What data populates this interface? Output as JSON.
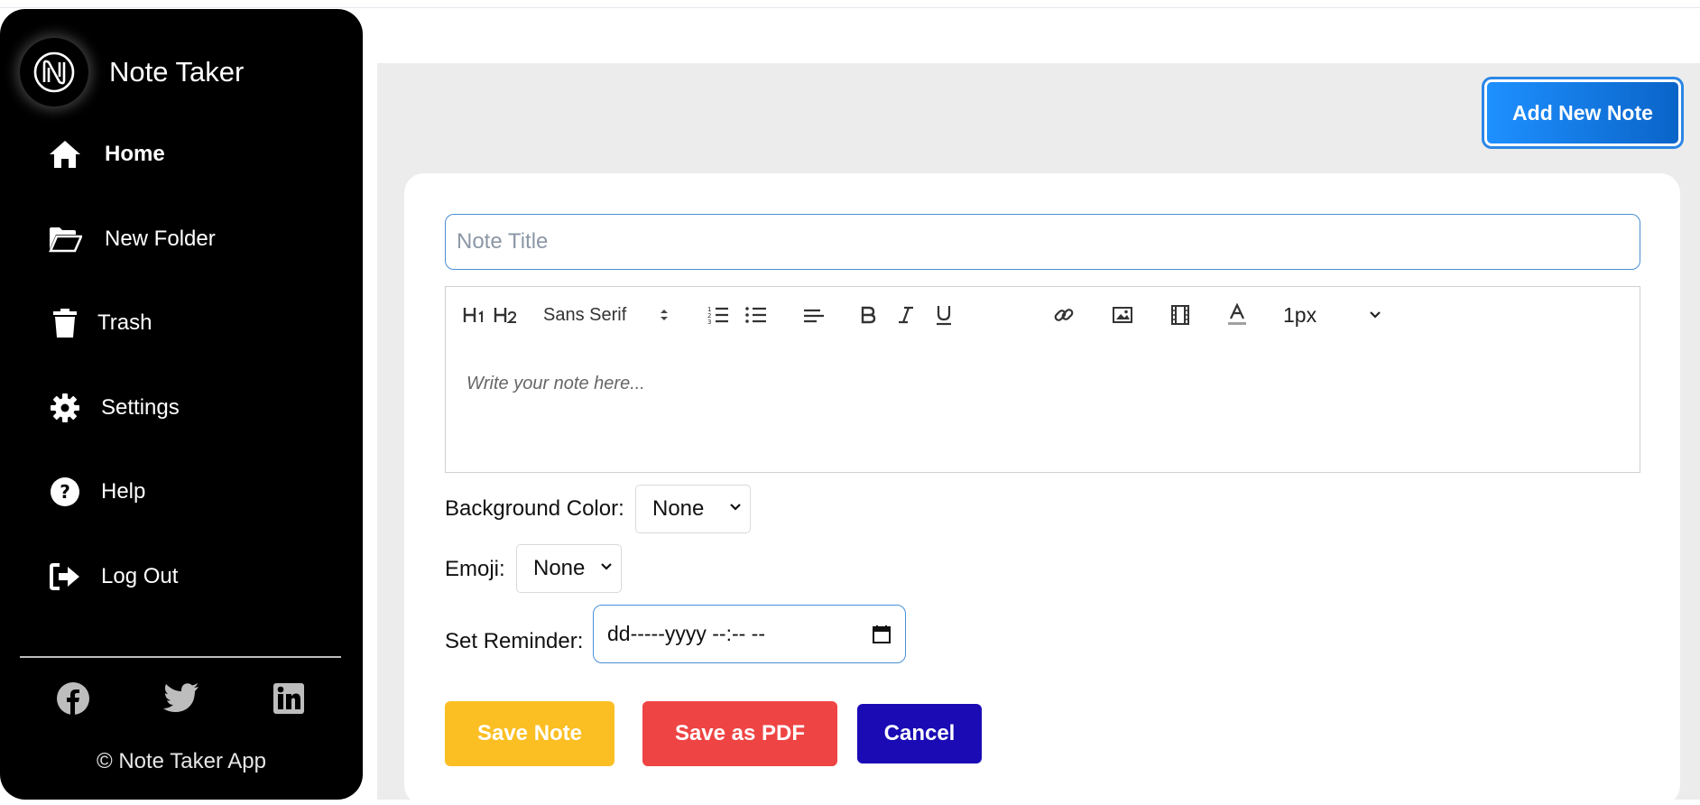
{
  "app": {
    "name": "Note Taker",
    "logo_icon": "n-logo-icon"
  },
  "sidebar": {
    "items": [
      {
        "label": "Home",
        "icon": "home-icon",
        "active": true
      },
      {
        "label": "New Folder",
        "icon": "folder-open-icon",
        "active": false
      },
      {
        "label": "Trash",
        "icon": "trash-icon",
        "active": false
      },
      {
        "label": "Settings",
        "icon": "gear-icon",
        "active": false
      },
      {
        "label": "Help",
        "icon": "question-circle-icon",
        "active": false
      },
      {
        "label": "Log Out",
        "icon": "logout-icon",
        "active": false
      }
    ],
    "social": [
      "facebook-icon",
      "twitter-icon",
      "linkedin-icon"
    ],
    "copyright": "© Note Taker App"
  },
  "header": {
    "add_note_label": "Add New Note"
  },
  "editor": {
    "title_placeholder": "Note Title",
    "body_placeholder": "Write your note here...",
    "toolbar": {
      "h1": "H1",
      "h2": "H2",
      "font": "Sans Serif",
      "size": "1px"
    }
  },
  "options": {
    "background_label": "Background Color:",
    "background_value": "None",
    "emoji_label": "Emoji:",
    "emoji_value": "None",
    "reminder_label": "Set Reminder:",
    "reminder_value": "dd-----yyyy --:-- --"
  },
  "actions": {
    "save": "Save Note",
    "pdf": "Save as PDF",
    "cancel": "Cancel"
  },
  "colors": {
    "sidebar_bg": "#000000",
    "add_btn": "#1e90ff",
    "save_btn": "#fbbf24",
    "pdf_btn": "#ef4444",
    "cancel_btn": "#1a0bb5"
  }
}
